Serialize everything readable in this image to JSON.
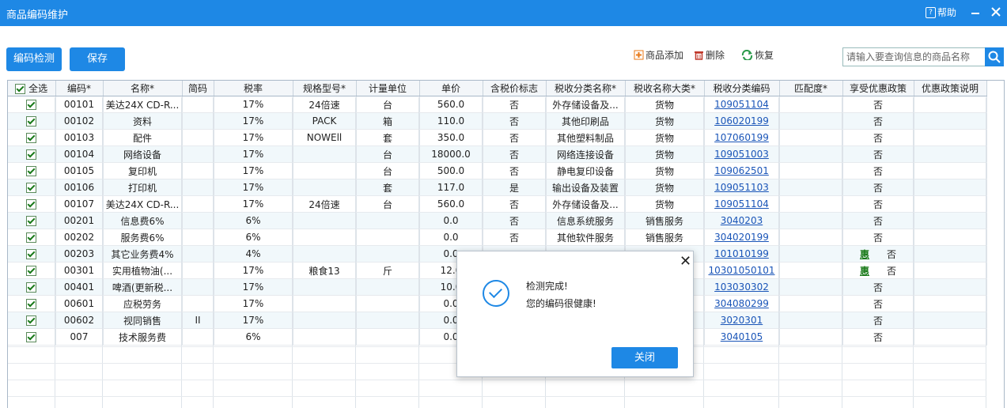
{
  "window": {
    "title": "商品编码维护",
    "help_label": "帮助"
  },
  "toolbar": {
    "check_code_label": "编码检测",
    "save_label": "保存",
    "add_label": "商品添加",
    "delete_label": "删除",
    "restore_label": "恢复",
    "search_placeholder": "请输入要查询信息的商品名称"
  },
  "table": {
    "select_all_label": "全选",
    "headers": [
      "编码*",
      "名称*",
      "简码",
      "税率",
      "规格型号*",
      "计量单位",
      "单价",
      "含税价标志",
      "税收分类名称*",
      "税收名称大类*",
      "税收分类编码",
      "匹配度*",
      "享受优惠政策",
      "优惠政策说明"
    ],
    "rows": [
      {
        "code": "00101",
        "name": "美达24X CD-R...",
        "short": "",
        "rate": "17%",
        "spec": "24倍速",
        "unit": "台",
        "price": "560.0",
        "tax_flag": "否",
        "tax_cat_name": "外存储设备及...",
        "tax_major": "货物",
        "tax_code": "109051104",
        "match": "",
        "policy_badge": "",
        "policy": "否",
        "policy_desc": ""
      },
      {
        "code": "00102",
        "name": "资料",
        "short": "",
        "rate": "17%",
        "spec": "PACK",
        "unit": "箱",
        "price": "110.0",
        "tax_flag": "否",
        "tax_cat_name": "其他印刷品",
        "tax_major": "货物",
        "tax_code": "106020199",
        "match": "",
        "policy_badge": "",
        "policy": "否",
        "policy_desc": ""
      },
      {
        "code": "00103",
        "name": "配件",
        "short": "",
        "rate": "17%",
        "spec": "NOWEll",
        "unit": "套",
        "price": "350.0",
        "tax_flag": "否",
        "tax_cat_name": "其他塑料制品",
        "tax_major": "货物",
        "tax_code": "107060199",
        "match": "",
        "policy_badge": "",
        "policy": "否",
        "policy_desc": ""
      },
      {
        "code": "00104",
        "name": "网络设备",
        "short": "",
        "rate": "17%",
        "spec": "",
        "unit": "台",
        "price": "18000.0",
        "tax_flag": "否",
        "tax_cat_name": "网络连接设备",
        "tax_major": "货物",
        "tax_code": "109051003",
        "match": "",
        "policy_badge": "",
        "policy": "否",
        "policy_desc": ""
      },
      {
        "code": "00105",
        "name": "复印机",
        "short": "",
        "rate": "17%",
        "spec": "",
        "unit": "台",
        "price": "500.0",
        "tax_flag": "否",
        "tax_cat_name": "静电复印设备",
        "tax_major": "货物",
        "tax_code": "109062501",
        "match": "",
        "policy_badge": "",
        "policy": "否",
        "policy_desc": ""
      },
      {
        "code": "00106",
        "name": "打印机",
        "short": "",
        "rate": "17%",
        "spec": "",
        "unit": "套",
        "price": "117.0",
        "tax_flag": "是",
        "tax_cat_name": "输出设备及装置",
        "tax_major": "货物",
        "tax_code": "109051103",
        "match": "",
        "policy_badge": "",
        "policy": "否",
        "policy_desc": ""
      },
      {
        "code": "00107",
        "name": "美达24X CD-R...",
        "short": "",
        "rate": "17%",
        "spec": "24倍速",
        "unit": "台",
        "price": "560.0",
        "tax_flag": "否",
        "tax_cat_name": "外存储设备及...",
        "tax_major": "货物",
        "tax_code": "109051104",
        "match": "",
        "policy_badge": "",
        "policy": "否",
        "policy_desc": ""
      },
      {
        "code": "00201",
        "name": "信息费6%",
        "short": "",
        "rate": "6%",
        "spec": "",
        "unit": "",
        "price": "0.0",
        "tax_flag": "否",
        "tax_cat_name": "信息系统服务",
        "tax_major": "销售服务",
        "tax_code": "3040203",
        "match": "",
        "policy_badge": "",
        "policy": "否",
        "policy_desc": ""
      },
      {
        "code": "00202",
        "name": "服务费6%",
        "short": "",
        "rate": "6%",
        "spec": "",
        "unit": "",
        "price": "0.0",
        "tax_flag": "否",
        "tax_cat_name": "其他软件服务",
        "tax_major": "销售服务",
        "tax_code": "304020199",
        "match": "",
        "policy_badge": "",
        "policy": "否",
        "policy_desc": ""
      },
      {
        "code": "00203",
        "name": "其它业务费4%",
        "short": "",
        "rate": "4%",
        "spec": "",
        "unit": "",
        "price": "0.0",
        "tax_flag": "",
        "tax_cat_name": "",
        "tax_major": "",
        "tax_code": "101010199",
        "match": "",
        "policy_badge": "惠",
        "policy": "否",
        "policy_desc": ""
      },
      {
        "code": "00301",
        "name": "实用植物油(...",
        "short": "",
        "rate": "17%",
        "spec": "粮食13",
        "unit": "斤",
        "price": "12.0",
        "tax_flag": "",
        "tax_cat_name": "",
        "tax_major": "",
        "tax_code": "10301050101",
        "match": "",
        "policy_badge": "惠",
        "policy": "否",
        "policy_desc": ""
      },
      {
        "code": "00401",
        "name": "啤酒(更新税...",
        "short": "",
        "rate": "17%",
        "spec": "",
        "unit": "",
        "price": "10.0",
        "tax_flag": "",
        "tax_cat_name": "",
        "tax_major": "",
        "tax_code": "103030302",
        "match": "",
        "policy_badge": "",
        "policy": "否",
        "policy_desc": ""
      },
      {
        "code": "00601",
        "name": "应税劳务",
        "short": "",
        "rate": "17%",
        "spec": "",
        "unit": "",
        "price": "0.0",
        "tax_flag": "",
        "tax_cat_name": "",
        "tax_major": "",
        "tax_code": "304080299",
        "match": "",
        "policy_badge": "",
        "policy": "否",
        "policy_desc": ""
      },
      {
        "code": "00602",
        "name": "视同销售",
        "short": "II",
        "rate": "17%",
        "spec": "",
        "unit": "",
        "price": "0.0",
        "tax_flag": "",
        "tax_cat_name": "",
        "tax_major": "",
        "tax_code": "3020301",
        "match": "",
        "policy_badge": "",
        "policy": "否",
        "policy_desc": ""
      },
      {
        "code": "007",
        "name": "技术服务费",
        "short": "",
        "rate": "6%",
        "spec": "",
        "unit": "",
        "price": "0.0",
        "tax_flag": "",
        "tax_cat_name": "",
        "tax_major": "",
        "tax_code": "3040105",
        "match": "",
        "policy_badge": "",
        "policy": "否",
        "policy_desc": ""
      }
    ]
  },
  "dialog": {
    "line1": "检测完成!",
    "line2": "您的编码很健康!",
    "close_label": "关闭"
  },
  "colors": {
    "accent": "#1e88e5",
    "link": "#1a55b8",
    "badge": "#1a7a1a",
    "row_alt": "#f1f8fb"
  }
}
